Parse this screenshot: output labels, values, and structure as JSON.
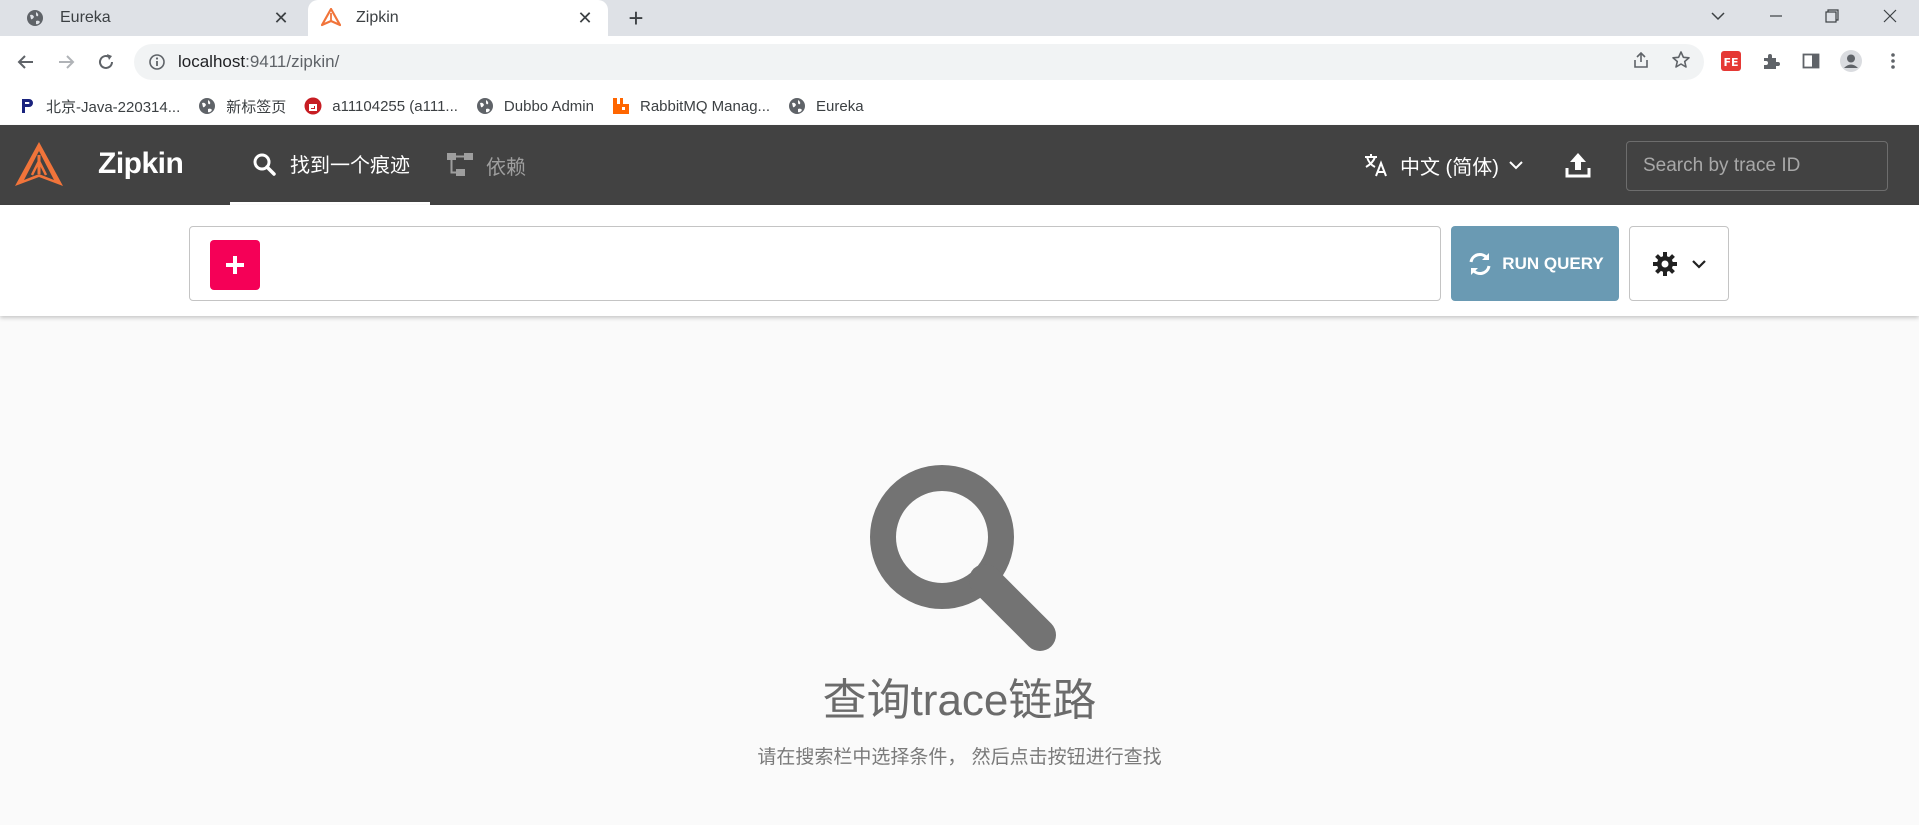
{
  "browser": {
    "tabs": [
      {
        "title": "Eureka",
        "icon": "globe-icon",
        "active": false
      },
      {
        "title": "Zipkin",
        "icon": "zipkin-icon",
        "active": true
      }
    ],
    "url_host": "localhost",
    "url_rest": ":9411/zipkin/",
    "bookmarks": [
      {
        "label": "北京-Java-220314...",
        "icon": "p-icon"
      },
      {
        "label": "新标签页",
        "icon": "globe-icon"
      },
      {
        "label": "a11104255 (a111...",
        "icon": "gitee-icon"
      },
      {
        "label": "Dubbo Admin",
        "icon": "globe-icon"
      },
      {
        "label": "RabbitMQ Manag...",
        "icon": "rabbitmq-icon"
      },
      {
        "label": "Eureka",
        "icon": "globe-icon"
      }
    ]
  },
  "header": {
    "brand": "Zipkin",
    "tabs": [
      {
        "label": "找到一个痕迹",
        "icon": "search-icon",
        "active": true
      },
      {
        "label": "依赖",
        "icon": "dependencies-icon",
        "active": false
      }
    ],
    "language": "中文 (简体)",
    "search_placeholder": "Search by trace ID"
  },
  "query": {
    "run_label": "RUN QUERY"
  },
  "empty_state": {
    "title": "查询trace链路",
    "subtitle": "请在搜索栏中选择条件， 然后点击按钮进行查找"
  },
  "colors": {
    "header_bg": "#424242",
    "add_button": "#f50057",
    "run_button": "#6a9ab3",
    "brand_orange": "#f1743a"
  }
}
